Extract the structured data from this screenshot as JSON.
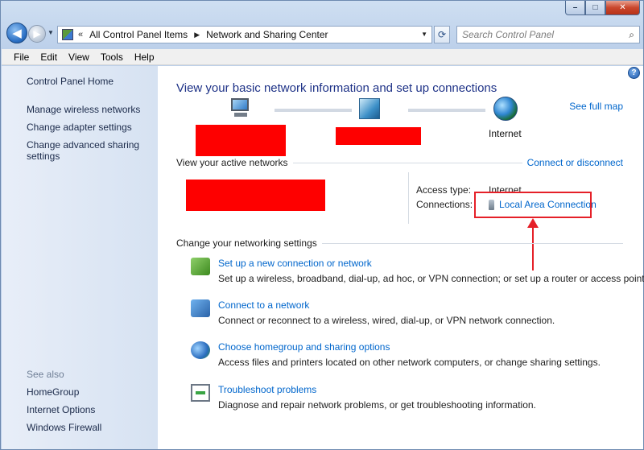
{
  "window": {
    "caption_min": "–",
    "caption_max": "□",
    "caption_close": "✕"
  },
  "nav": {
    "back_glyph": "◀",
    "forward_glyph": "▶",
    "breadcrumb_chevron": "«",
    "crumbs": [
      "All Control Panel Items",
      "Network and Sharing Center"
    ],
    "crumb_separator": "▶",
    "dropdown_glyph": "▼",
    "refresh_glyph": "⟳",
    "search_placeholder": "Search Control Panel",
    "search_glyph": "⌕"
  },
  "menubar": [
    "File",
    "Edit",
    "View",
    "Tools",
    "Help"
  ],
  "sidebar": {
    "home": "Control Panel Home",
    "links": [
      "Manage wireless networks",
      "Change adapter settings",
      "Change advanced sharing",
      "settings"
    ],
    "see_also_heading": "See also",
    "see_also": [
      "HomeGroup",
      "Internet Options",
      "Windows Firewall"
    ]
  },
  "main": {
    "help_glyph": "?",
    "title": "View your basic network information and set up connections",
    "see_full_map": "See full map",
    "internet_label": "Internet",
    "active_networks_heading": "View your active networks",
    "connect_or_disconnect": "Connect or disconnect",
    "access_type_label": "Access type:",
    "access_type_value": "Internet",
    "connections_label": "Connections:",
    "connection_name": "Local Area Connection",
    "settings_heading": "Change your networking settings",
    "tasks": [
      {
        "link": "Set up a new connection or network",
        "desc": "Set up a wireless, broadband, dial-up, ad hoc, or VPN connection; or set up a router or access point."
      },
      {
        "link": "Connect to a network",
        "desc": "Connect or reconnect to a wireless, wired, dial-up, or VPN network connection."
      },
      {
        "link": "Choose homegroup and sharing options",
        "desc": "Access files and printers located on other network computers, or change sharing settings."
      },
      {
        "link": "Troubleshoot problems",
        "desc": "Diagnose and repair network problems, or get troubleshooting information."
      }
    ]
  },
  "colors": {
    "link": "#0066cc",
    "title": "#1e3287",
    "annotation": "#e52028",
    "redaction": "#fe0000"
  },
  "icons": [
    "back-arrow-icon",
    "forward-arrow-icon",
    "control-panel-icon",
    "refresh-icon",
    "search-icon",
    "help-icon",
    "computer-icon",
    "network-hub-icon",
    "globe-icon",
    "plug-icon",
    "new-connection-icon",
    "connect-network-icon",
    "homegroup-icon",
    "troubleshoot-icon"
  ]
}
